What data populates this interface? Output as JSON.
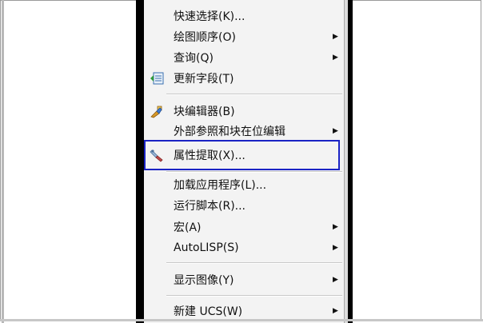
{
  "menu": {
    "items": [
      {
        "label": "快速选择(K)...",
        "submenu": false,
        "icon": ""
      },
      {
        "label": "绘图顺序(O)",
        "submenu": true,
        "icon": ""
      },
      {
        "label": "查询(Q)",
        "submenu": true,
        "icon": ""
      },
      {
        "label": "更新字段(T)",
        "submenu": false,
        "icon": "update-fields-icon"
      },
      {
        "label": "块编辑器(B)",
        "submenu": false,
        "icon": "block-editor-icon"
      },
      {
        "label": "外部参照和块在位编辑",
        "submenu": true,
        "icon": ""
      },
      {
        "label": "属性提取(X)...",
        "submenu": false,
        "icon": "attribute-extract-icon"
      },
      {
        "label": "加载应用程序(L)...",
        "submenu": false,
        "icon": ""
      },
      {
        "label": "运行脚本(R)...",
        "submenu": false,
        "icon": ""
      },
      {
        "label": "宏(A)",
        "submenu": true,
        "icon": ""
      },
      {
        "label": "AutoLISP(S)",
        "submenu": true,
        "icon": ""
      },
      {
        "label": "显示图像(Y)",
        "submenu": true,
        "icon": ""
      },
      {
        "label": "新建 UCS(W)",
        "submenu": true,
        "icon": ""
      }
    ],
    "submenu_arrow": "▶",
    "highlight_color": "#1a23c4"
  }
}
